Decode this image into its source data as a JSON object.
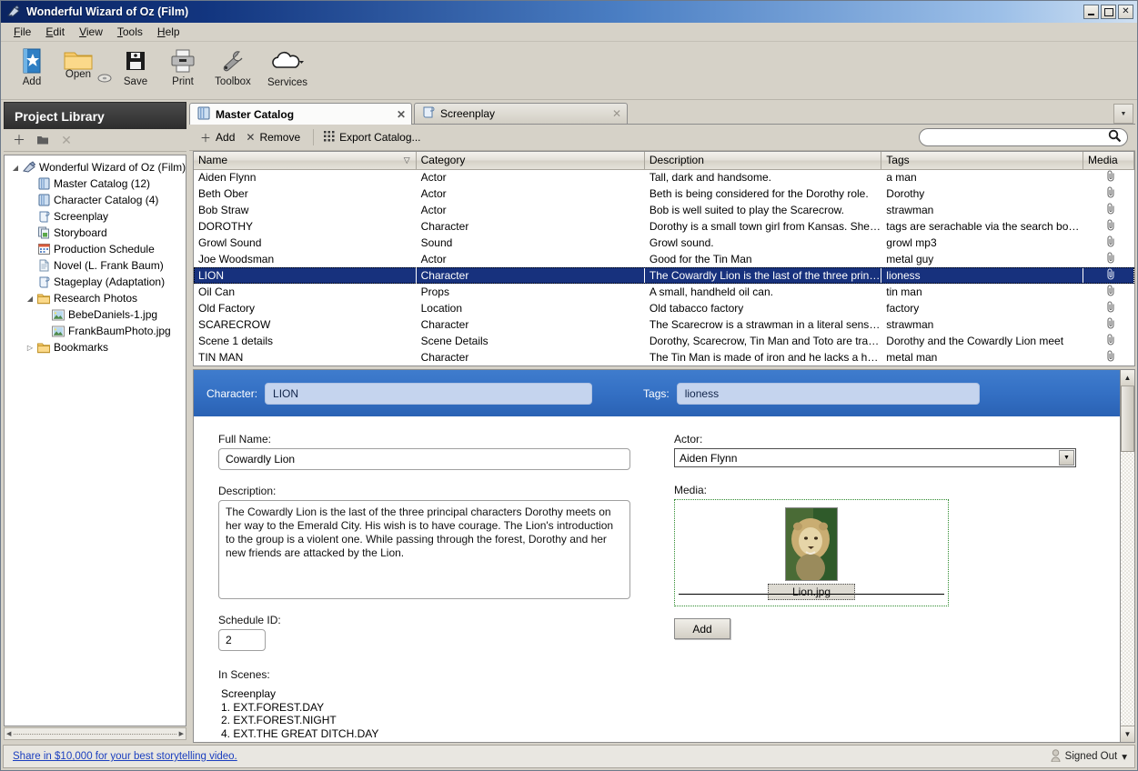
{
  "window": {
    "title": "Wonderful Wizard of Oz (Film)",
    "minimize": "_",
    "maximize": "□",
    "close": "✕"
  },
  "menubar": {
    "items": [
      "File",
      "Edit",
      "View",
      "Tools",
      "Help"
    ]
  },
  "toolbar": {
    "buttons": [
      {
        "label": "Add",
        "icon": "add-star-icon"
      },
      {
        "label": "Open",
        "icon": "open-folder-icon"
      },
      {
        "label": "Save",
        "icon": "save-floppy-icon"
      },
      {
        "label": "Print",
        "icon": "printer-icon"
      },
      {
        "label": "Toolbox",
        "icon": "wrench-icon"
      },
      {
        "label": "Services",
        "icon": "cloud-icon"
      }
    ]
  },
  "sidebar": {
    "header": "Project Library",
    "tools": [
      {
        "name": "add-item",
        "glyph": "＋"
      },
      {
        "name": "new-folder",
        "glyph": "▬"
      },
      {
        "name": "delete-item",
        "glyph": "✕"
      }
    ],
    "tree": [
      {
        "label": "Wonderful Wizard of Oz (Film)",
        "icon": "project-icon",
        "indent": 0,
        "arrow": "◢"
      },
      {
        "label": "Master Catalog (12)",
        "icon": "book-icon",
        "indent": 1,
        "arrow": ""
      },
      {
        "label": "Character Catalog (4)",
        "icon": "book-icon",
        "indent": 1,
        "arrow": ""
      },
      {
        "label": "Screenplay",
        "icon": "script-icon",
        "indent": 1,
        "arrow": ""
      },
      {
        "label": "Storyboard",
        "icon": "storyboard-icon",
        "indent": 1,
        "arrow": ""
      },
      {
        "label": "Production Schedule",
        "icon": "calendar-icon",
        "indent": 1,
        "arrow": ""
      },
      {
        "label": "Novel (L. Frank Baum)",
        "icon": "document-icon",
        "indent": 1,
        "arrow": ""
      },
      {
        "label": "Stageplay (Adaptation)",
        "icon": "script-icon",
        "indent": 1,
        "arrow": ""
      },
      {
        "label": "Research Photos",
        "icon": "folder-icon",
        "indent": 1,
        "arrow": "◢"
      },
      {
        "label": "BebeDaniels-1.jpg",
        "icon": "image-icon",
        "indent": 2,
        "arrow": ""
      },
      {
        "label": "FrankBaumPhoto.jpg",
        "icon": "image-icon",
        "indent": 2,
        "arrow": ""
      },
      {
        "label": "Bookmarks",
        "icon": "folder-icon",
        "indent": 1,
        "arrow": "▷"
      }
    ]
  },
  "tabs": [
    {
      "label": "Master Catalog",
      "icon": "book-icon",
      "active": true,
      "close": "✕"
    },
    {
      "label": "Screenplay",
      "icon": "script-icon",
      "active": false,
      "close": "✕"
    }
  ],
  "catalog_toolbar": {
    "add_label": "Add",
    "add_icon": "＋",
    "remove_label": "Remove",
    "remove_icon": "✕",
    "export_label": "Export Catalog...",
    "export_icon": "▒"
  },
  "search": {
    "value": "",
    "placeholder": "",
    "icon": "search-icon"
  },
  "grid": {
    "columns": [
      "Name",
      "Category",
      "Description",
      "Tags",
      "Media"
    ],
    "sort_column": "Name",
    "sort_glyph": "▽",
    "media_glyph": "📎",
    "rows": [
      {
        "name": "Aiden Flynn",
        "category": "Actor",
        "description": "Tall, dark and handsome.",
        "tags": "a man",
        "selected": false
      },
      {
        "name": "Beth Ober",
        "category": "Actor",
        "description": "Beth is being considered for the Dorothy role.",
        "tags": "Dorothy",
        "selected": false
      },
      {
        "name": "Bob Straw",
        "category": "Actor",
        "description": "Bob is well suited to play the Scarecrow.",
        "tags": "strawman",
        "selected": false
      },
      {
        "name": "DOROTHY",
        "category": "Character",
        "description": "Dorothy is a small town girl from Kansas. She is an...",
        "tags": "tags are serachable via the search box above",
        "selected": false
      },
      {
        "name": "Growl Sound",
        "category": "Sound",
        "description": "Growl sound.",
        "tags": "growl mp3",
        "selected": false
      },
      {
        "name": "Joe Woodsman",
        "category": "Actor",
        "description": "Good for the Tin Man",
        "tags": "metal guy",
        "selected": false
      },
      {
        "name": "LION",
        "category": "Character",
        "description": "The Cowardly Lion is the last of the three principal...",
        "tags": "lioness",
        "selected": true
      },
      {
        "name": "Oil Can",
        "category": "Props",
        "description": "A small, handheld oil can.",
        "tags": "tin man",
        "selected": false
      },
      {
        "name": "Old Factory",
        "category": "Location",
        "description": "Old tabacco factory",
        "tags": "factory",
        "selected": false
      },
      {
        "name": "SCARECROW",
        "category": "Character",
        "description": "The Scarecrow is a strawman in a literal sense. He...",
        "tags": "strawman",
        "selected": false
      },
      {
        "name": "Scene 1 details",
        "category": "Scene Details",
        "description": "Dorothy, Scarecrow, Tin Man and Toto are travelli...",
        "tags": "Dorothy and the Cowardly Lion meet",
        "selected": false
      },
      {
        "name": "TIN MAN",
        "category": "Character",
        "description": "The Tin Man is made of iron and he lacks a heart. ...",
        "tags": "metal man",
        "selected": false
      }
    ]
  },
  "detail": {
    "character_label": "Character:",
    "character_value": "LION",
    "tags_label": "Tags:",
    "tags_value": "lioness",
    "full_name_label": "Full Name:",
    "full_name_value": "Cowardly Lion",
    "description_label": "Description:",
    "description_value": "The Cowardly Lion is the last of the three principal characters Dorothy meets on her way to the Emerald City.  His wish is to have courage. The Lion's introduction to the group is a violent one. While passing through the forest, Dorothy and her new friends are attacked by the Lion.",
    "schedule_id_label": "Schedule ID:",
    "schedule_id_value": "2",
    "in_scenes_label": "In Scenes:",
    "scenes_source": "Screenplay",
    "scenes": [
      "1. EXT.FOREST.DAY",
      "2. EXT.FOREST.NIGHT",
      "4. EXT.THE GREAT DITCH.DAY"
    ],
    "actor_label": "Actor:",
    "actor_value": "Aiden Flynn",
    "media_label": "Media:",
    "media_file": "Lion.jpg",
    "media_add_label": "Add"
  },
  "statusbar": {
    "promo": "Share in $10,000 for your best storytelling video.",
    "account": "Signed Out",
    "account_caret": "▾",
    "account_icon": "user-icon"
  },
  "colors": {
    "title_bar_dark": "#0b2461",
    "selection": "#17317d",
    "detail_header": "#3470c4",
    "link": "#1b3fbf",
    "sidebar_header": "#333333"
  }
}
